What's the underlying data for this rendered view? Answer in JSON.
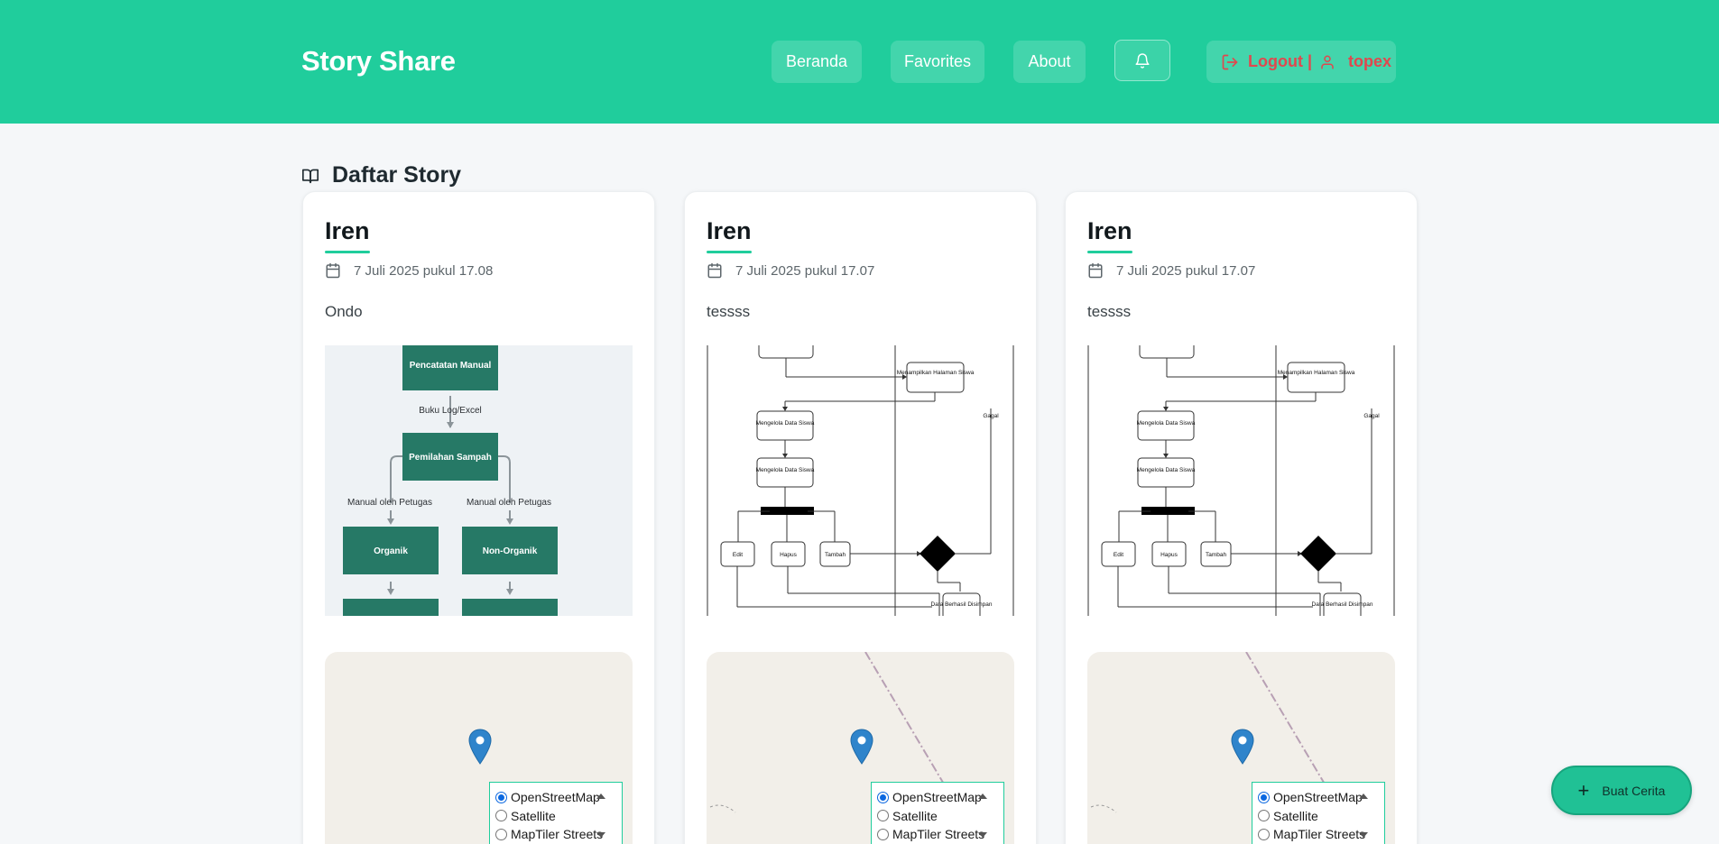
{
  "header": {
    "brand": "Story Share",
    "nav": {
      "home": "Beranda",
      "favorites": "Favorites",
      "about": "About",
      "logout": "Logout |",
      "username": "topex"
    }
  },
  "section": {
    "title": "Daftar Story"
  },
  "stories": [
    {
      "name": "Iren",
      "date": "7 Juli 2025 pukul 17.08",
      "description": "Ondo"
    },
    {
      "name": "Iren",
      "date": "7 Juli 2025 pukul 17.07",
      "description": "tessss"
    },
    {
      "name": "Iren",
      "date": "7 Juli 2025 pukul 17.07",
      "description": "tessss"
    }
  ],
  "map_layers": {
    "options": [
      "OpenStreetMap",
      "Satellite",
      "MapTiler Streets"
    ],
    "selected": "OpenStreetMap"
  },
  "flowchart_1": {
    "box_top": "Pencatatan Manual",
    "edge_1": "Buku Log/Excel",
    "box_mid": "Pemilahan Sampah",
    "edge_left": "Manual oleh Petugas",
    "edge_right": "Manual oleh Petugas",
    "box_left": "Organik",
    "box_right": "Non-Organik"
  },
  "activity_diagram": {
    "show": "Menampilkan Halaman Siswa",
    "manage_a": "Mengelola Data Siswa",
    "manage_b": "Mengelola Data Siswa",
    "edit": "Edit",
    "delete": "Hapus",
    "add": "Tambah",
    "fail": "Gagal",
    "success": "Data Berhasil Disimpan"
  },
  "fab": {
    "label": "Buat Cerita"
  },
  "colors": {
    "primary": "#20cd9c",
    "danger": "#e0484e",
    "map_bg": "#f2efe9",
    "marker": "#2f84cb"
  }
}
